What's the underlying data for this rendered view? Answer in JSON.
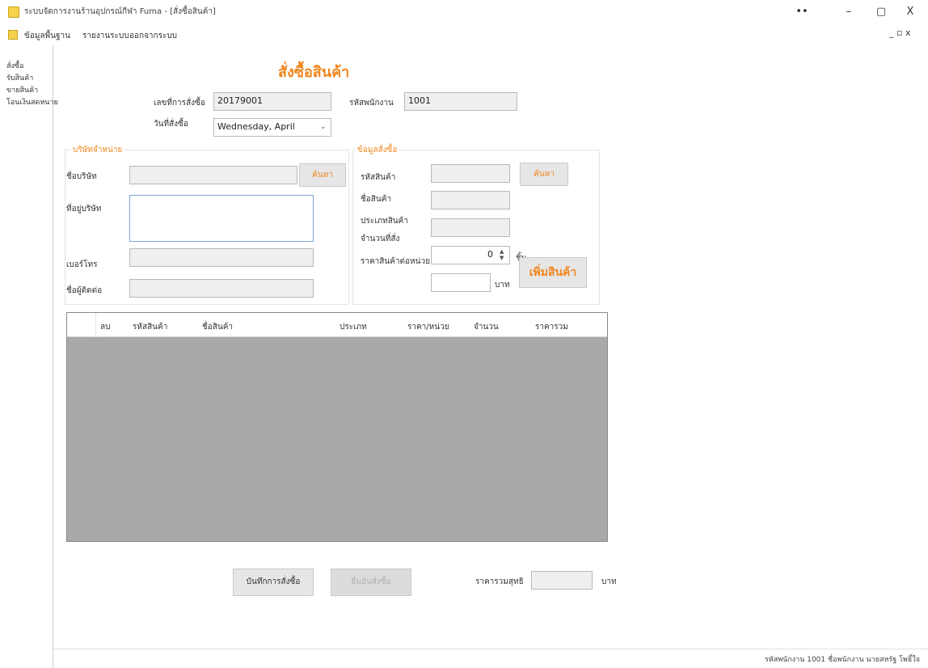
{
  "window": {
    "title": "ระบบจัดการงานร้านอุปกรณ์กีฬา Fuma - [สั่งซื้อสินค้า]",
    "menu": [
      "ข้อมูลพื้นฐาน",
      "รายงานระบบ",
      "ออกจากระบบ"
    ],
    "controls": {
      "minimize": "–",
      "maximize": "▢",
      "close": "X",
      "extra": "••"
    },
    "mdi_controls": "_ ▫ x"
  },
  "nav": [
    "สั่งซื้อ",
    "รับสินค้า",
    "ขายสินค้า",
    "โอนเงินสดหนาย"
  ],
  "form": {
    "title": "สั่งซื้อสินค้า",
    "order_no_label": "เลขที่การสั่งซื้อ",
    "order_no": "20179001",
    "employee_id_label": "รหัสพนักงาน",
    "employee_id": "1001",
    "order_date_label": "วันที่สั่งซื้อ",
    "order_date": "Wednesday,   April"
  },
  "supplier": {
    "legend": "บริษัทจำหน่าย",
    "company_label": "ชื่อบริษัท",
    "company": "",
    "search_label": "ค้นหา",
    "address_label": "ที่อยู่บริษัท",
    "address": "",
    "phone_label": "เบอร์โทร",
    "phone": "",
    "contact_label": "ชื่อผู้ติดต่อ",
    "contact": ""
  },
  "order_info": {
    "legend": "ข้อมูลสั่งซื้อ",
    "product_id_label": "รหัสสินค้า",
    "product_id": "",
    "search_label": "ค้นหา",
    "product_name_label": "ชื่อสินค้า",
    "product_name": "",
    "product_type_label": "ประเภทสินค้า",
    "product_type": "",
    "qty_label": "จำนวนที่สั่ง",
    "qty": "0",
    "qty_unit": "ชิ้น",
    "price_label": "ราคาสินค้าต่อหน่วย",
    "price": "",
    "price_unit": "บาท",
    "add_label": "เพิ่มสินค้า"
  },
  "grid": {
    "columns": [
      "ลบ",
      "รหัสสินค้า",
      "ชื่อสินค้า",
      "ประเภท",
      "ราคา/หน่วย",
      "จำนวน",
      "ราคารวม"
    ],
    "rows": []
  },
  "footer": {
    "save_label": "บันทึกการสั่งซื้อ",
    "cancel_label": "ยืนยันสั่งซื้อ",
    "total_label": "ราคารวมสุทธิ",
    "total": "",
    "total_unit": "บาท"
  },
  "status": "รหัสพนักงาน 1001  ชื่อพนักงาน นายสหรัฐ โพธิ์ใจ"
}
